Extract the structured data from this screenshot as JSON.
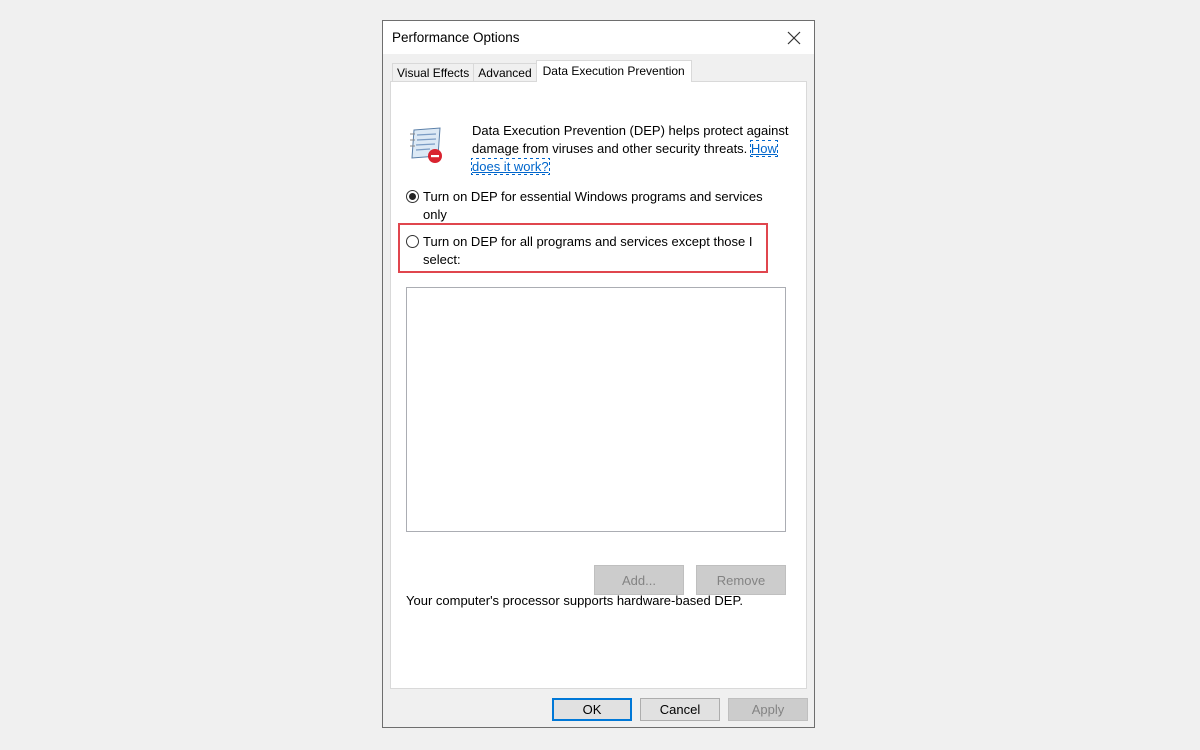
{
  "window": {
    "title": "Performance Options",
    "close_icon": "close-icon"
  },
  "tabs": [
    {
      "label": "Visual Effects",
      "active": false
    },
    {
      "label": "Advanced",
      "active": false
    },
    {
      "label": "Data Execution Prevention",
      "active": true
    }
  ],
  "dep": {
    "icon": "dep-shield-icon",
    "description": "Data Execution Prevention (DEP) helps protect against damage from viruses and other security threats.",
    "link_text": "How does it work?",
    "options": [
      {
        "label": "Turn on DEP for essential Windows programs and services only",
        "checked": true
      },
      {
        "label": "Turn on DEP for all programs and services except those I select:",
        "checked": false
      }
    ],
    "add_label": "Add...",
    "remove_label": "Remove",
    "support_text": "Your computer's processor supports hardware-based DEP."
  },
  "footer": {
    "ok_label": "OK",
    "cancel_label": "Cancel",
    "apply_label": "Apply"
  },
  "colors": {
    "highlight": "#e0464e",
    "link": "#0066cc",
    "default_button_border": "#0078d7"
  }
}
